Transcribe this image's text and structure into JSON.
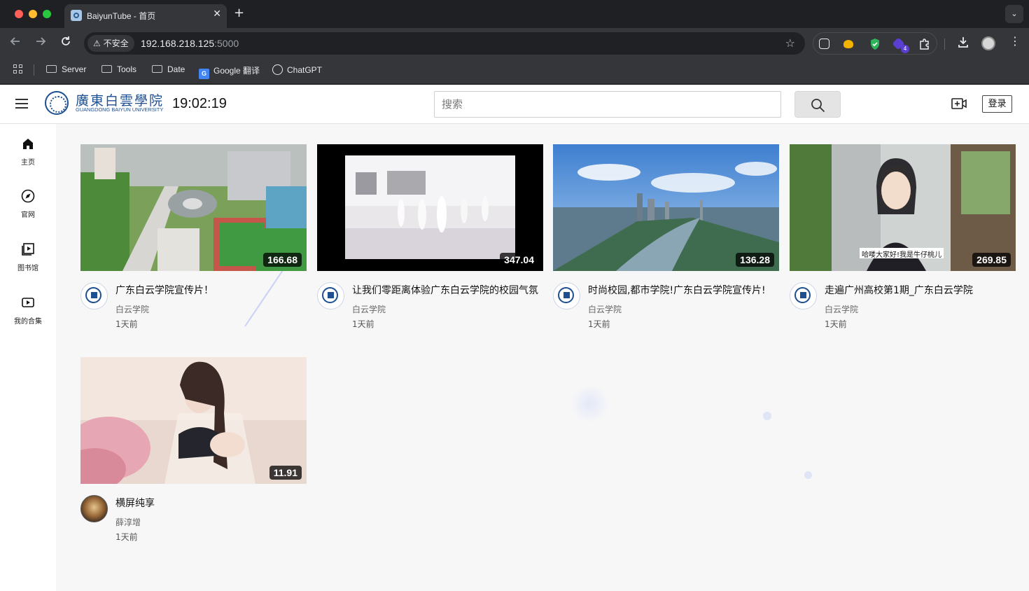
{
  "browser": {
    "tab_title": "BaiyunTube - 首页",
    "tab_close": "✕",
    "new_tab": "+",
    "tab_menu": "⌄",
    "insecure_label": "不安全",
    "url_host": "192.168.218.125",
    "url_port": ":5000",
    "bookmarks": [
      {
        "label": "Server",
        "icon": "folder-icon"
      },
      {
        "label": "Tools",
        "icon": "folder-icon"
      },
      {
        "label": "Date",
        "icon": "folder-icon"
      },
      {
        "label": "Google 翻译",
        "icon": "google-translate-icon"
      },
      {
        "label": "ChatGPT",
        "icon": "chatgpt-icon"
      }
    ],
    "extension_badge": "4"
  },
  "header": {
    "logo_cn": "廣東白雲學院",
    "logo_en": "GUANGDONG BAIYUN UNIVERSITY",
    "clock": "19:02:19",
    "search_placeholder": "搜索",
    "login_label": "登录"
  },
  "sidebar": {
    "items": [
      {
        "label": "主页",
        "icon": "home-icon"
      },
      {
        "label": "官网",
        "icon": "compass-icon"
      },
      {
        "label": "图书馆",
        "icon": "library-icon"
      },
      {
        "label": "我的合集",
        "icon": "playlist-icon"
      }
    ]
  },
  "videos": [
    {
      "title": "广东白云学院宣传片！",
      "channel": "白云学院",
      "time": "1天前",
      "duration": "166.68"
    },
    {
      "title": "让我们零距离体验广东白云学院的校园气氛",
      "channel": "白云学院",
      "time": "1天前",
      "duration": "347.04"
    },
    {
      "title": "时尚校园,都市学院!广东白云学院宣传片!",
      "channel": "白云学院",
      "time": "1天前",
      "duration": "136.28"
    },
    {
      "title": "走遍广州高校第1期_广东白云学院",
      "channel": "白云学院",
      "time": "1天前",
      "duration": "269.85",
      "thumb_caption": "哈喽大家好!我是牛仔桃儿"
    },
    {
      "title": "横屏纯享",
      "channel": "薛淳增",
      "time": "1天前",
      "duration": "11.91"
    }
  ],
  "colors": {
    "brand_blue": "#1d4f91",
    "page_bg": "#f7f7f8",
    "chrome_bg": "#35363a"
  }
}
